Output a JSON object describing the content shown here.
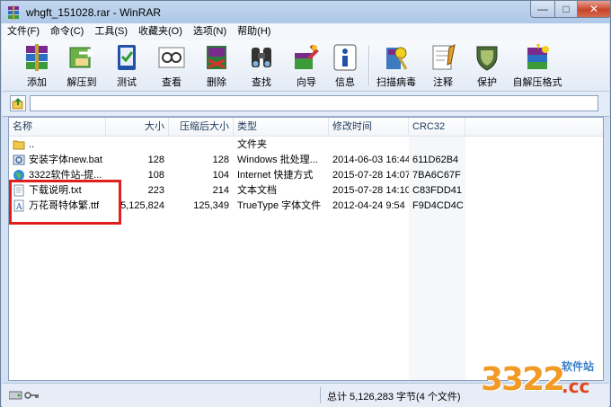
{
  "window": {
    "title": "whgft_151028.rar - WinRAR",
    "min_glyph": "—",
    "max_glyph": "□",
    "close_glyph": "✕"
  },
  "menu": [
    "文件(F)",
    "命令(C)",
    "工具(S)",
    "收藏夹(O)",
    "选项(N)",
    "帮助(H)"
  ],
  "toolbar": [
    "添加",
    "解压到",
    "测试",
    "查看",
    "删除",
    "查找",
    "向导",
    "信息",
    "扫描病毒",
    "注释",
    "保护",
    "自解压格式"
  ],
  "columns": {
    "name": "名称",
    "size": "大小",
    "packed": "压缩后大小",
    "type": "类型",
    "modified": "修改时间",
    "crc": "CRC32"
  },
  "files": [
    {
      "name": "..",
      "size": "",
      "packed": "",
      "type": "文件夹",
      "modified": "",
      "crc": "",
      "icon": "folder-icon"
    },
    {
      "name": "安装字体new.bat",
      "size": "128",
      "packed": "128",
      "type": "Windows 批处理...",
      "modified": "2014-06-03 16:44",
      "crc": "611D62B4",
      "icon": "batch-file-icon"
    },
    {
      "name": "3322软件站-提...",
      "size": "108",
      "packed": "104",
      "type": "Internet 快捷方式",
      "modified": "2015-07-28 14:07",
      "crc": "7BA6C67F",
      "icon": "internet-shortcut-icon"
    },
    {
      "name": "下载说明.txt",
      "size": "223",
      "packed": "214",
      "type": "文本文档",
      "modified": "2015-07-28 14:10",
      "crc": "C83FDD41",
      "icon": "text-file-icon"
    },
    {
      "name": "万花哥特体繁.ttf",
      "size": "5,125,824",
      "packed": "125,349",
      "type": "TrueType 字体文件",
      "modified": "2012-04-24 9:54",
      "crc": "F9D4CD4C",
      "icon": "font-file-icon"
    }
  ],
  "status": {
    "text": "总计 5,126,283 字节(4 个文件)"
  },
  "watermark": {
    "number": "3322",
    "tld": ".cc",
    "label": "软件站"
  },
  "colors": {
    "highlight": "#e0201e",
    "accent": "#f19a26"
  }
}
